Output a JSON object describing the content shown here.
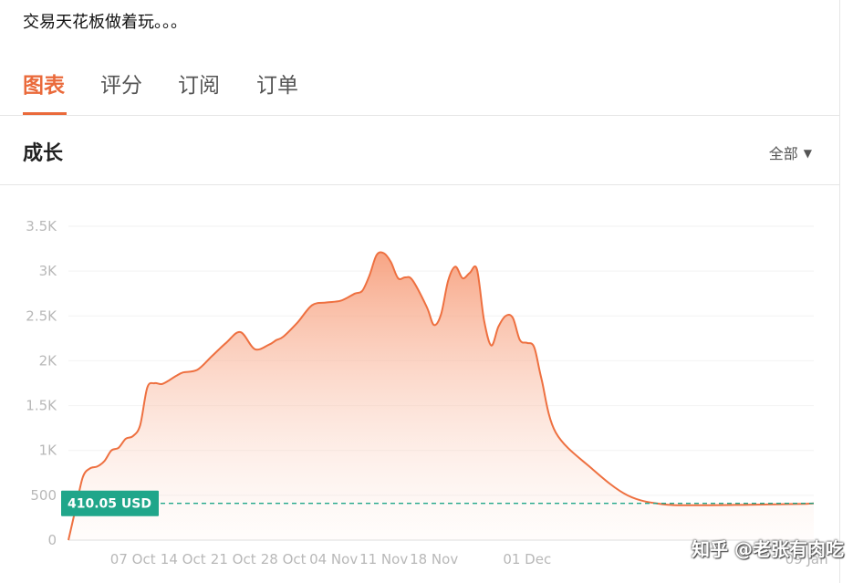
{
  "header": {
    "title": "交易天花板做着玩。。。"
  },
  "tabs": [
    {
      "label": "图表",
      "active": true
    },
    {
      "label": "评分",
      "active": false
    },
    {
      "label": "订阅",
      "active": false
    },
    {
      "label": "订单",
      "active": false
    }
  ],
  "section": {
    "title": "成长",
    "range_label": "全部"
  },
  "watermark": "知乎 @老张有肉吃",
  "colors": {
    "accent": "#ea6a3b",
    "line": "#ee7040",
    "marker": "#20a68a",
    "axis_text": "#b8b8b8"
  },
  "chart_data": {
    "type": "area",
    "ylim": [
      0,
      3500
    ],
    "y_ticks": [
      0,
      500,
      1000,
      1500,
      2000,
      2500,
      3000,
      3500
    ],
    "y_tick_labels": [
      "0",
      "500",
      "1K",
      "1.5K",
      "2K",
      "2.5K",
      "3K",
      "3.5K"
    ],
    "x_range": [
      "2021-09-28",
      "2022-01-10"
    ],
    "x_tick_labels": [
      "07 Oct",
      "14 Oct",
      "21 Oct",
      "28 Oct",
      "04 Nov",
      "11 Nov",
      "18 Nov",
      "01 Dec",
      "09 Jan"
    ],
    "x_tick_dates": [
      "2021-10-07",
      "2021-10-14",
      "2021-10-21",
      "2021-10-28",
      "2021-11-04",
      "2021-11-11",
      "2021-11-18",
      "2021-12-01",
      "2022-01-09"
    ],
    "current_value": 410.05,
    "current_value_label": "410.05 USD",
    "x": [
      "2021-09-28",
      "2021-09-29",
      "2021-09-30",
      "2021-10-01",
      "2021-10-02",
      "2021-10-03",
      "2021-10-04",
      "2021-10-05",
      "2021-10-06",
      "2021-10-07",
      "2021-10-08",
      "2021-10-09",
      "2021-10-10",
      "2021-10-11",
      "2021-10-12",
      "2021-10-13",
      "2021-10-14",
      "2021-10-16",
      "2021-10-18",
      "2021-10-20",
      "2021-10-22",
      "2021-10-24",
      "2021-10-26",
      "2021-10-27",
      "2021-10-28",
      "2021-10-30",
      "2021-11-01",
      "2021-11-03",
      "2021-11-05",
      "2021-11-07",
      "2021-11-08",
      "2021-11-09",
      "2021-11-10",
      "2021-11-11",
      "2021-11-12",
      "2021-11-13",
      "2021-11-14",
      "2021-11-15",
      "2021-11-17",
      "2021-11-18",
      "2021-11-19",
      "2021-11-20",
      "2021-11-21",
      "2021-11-22",
      "2021-11-23",
      "2021-11-24",
      "2021-11-25",
      "2021-11-26",
      "2021-11-27",
      "2021-11-28",
      "2021-11-29",
      "2021-11-30",
      "2021-12-01",
      "2021-12-02",
      "2021-12-03",
      "2021-12-05",
      "2021-12-10",
      "2021-12-15",
      "2021-12-20",
      "2021-12-26",
      "2022-01-01",
      "2022-01-05",
      "2022-01-09",
      "2022-01-10"
    ],
    "values": [
      0,
      350,
      700,
      800,
      820,
      880,
      1000,
      1030,
      1130,
      1160,
      1280,
      1700,
      1750,
      1740,
      1780,
      1830,
      1870,
      1900,
      2050,
      2200,
      2320,
      2130,
      2180,
      2230,
      2270,
      2430,
      2620,
      2650,
      2670,
      2750,
      2780,
      2950,
      3180,
      3200,
      3100,
      2920,
      2930,
      2900,
      2600,
      2400,
      2520,
      2900,
      3050,
      2920,
      2980,
      3020,
      2450,
      2170,
      2380,
      2500,
      2480,
      2230,
      2200,
      2150,
      1800,
      1200,
      800,
      500,
      400,
      390,
      395,
      400,
      405,
      410.05
    ]
  }
}
